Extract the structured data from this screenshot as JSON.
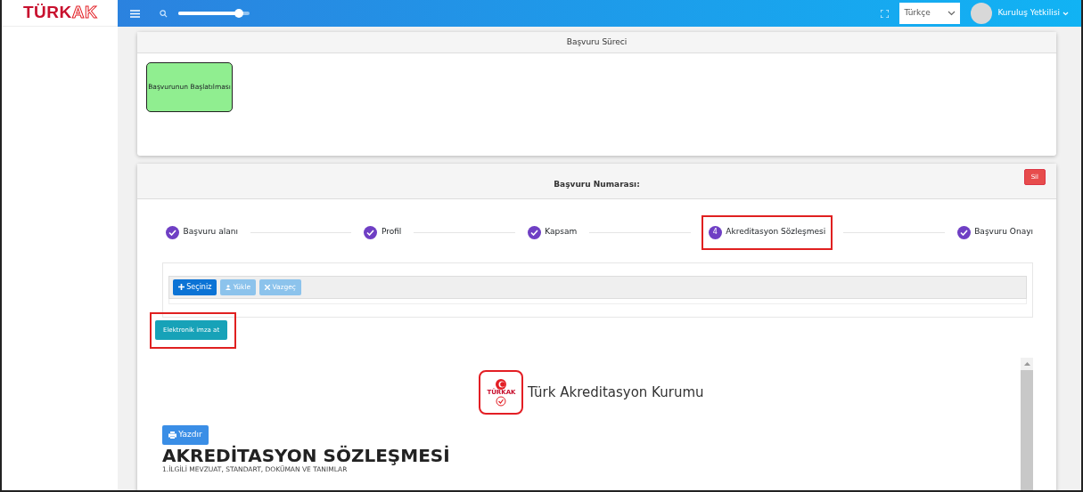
{
  "brand": {
    "main": "TÜRK",
    "accent": "AK"
  },
  "topbar": {
    "search_slider": {
      "level": 0.85
    },
    "language": "Türkçe",
    "user": "Kuruluş Yetkilisi"
  },
  "process_card": {
    "title": "Başvuru Süreci",
    "stages": [
      {
        "label": "Başvurunun Başlatılması",
        "color": "#90ee90"
      }
    ]
  },
  "application_card": {
    "title": "Başvuru Numarası:",
    "delete_button": "Sil",
    "steps": [
      {
        "label": "Başvuru alanı",
        "completed": true,
        "highlighted": false
      },
      {
        "label": "Profil",
        "completed": true,
        "highlighted": false
      },
      {
        "label": "Kapsam",
        "completed": true,
        "highlighted": false
      },
      {
        "number": "4",
        "label": "Akreditasyon Sözleşmesi",
        "completed": false,
        "highlighted": true
      },
      {
        "label": "Başvuru Onayı",
        "completed": true,
        "highlighted": false
      }
    ],
    "upload": {
      "buttons": [
        {
          "kind": "choose",
          "label": "Seçiniz",
          "disabled": false
        },
        {
          "kind": "upload",
          "label": "Yükle",
          "disabled": true
        },
        {
          "kind": "cancel",
          "label": "Vazgeç",
          "disabled": true
        }
      ]
    },
    "sign_button": {
      "label": "Elektronik imza at",
      "highlighted": true
    },
    "document": {
      "emblem_text": "TÜRKAK",
      "org_name": "Türk Akreditasyon Kurumu",
      "print_button": "Yazdır",
      "title": "AKREDİTASYON SÖZLEŞMESİ",
      "section": "1.İLGİLİ MEVZUAT, STANDART, DOKÜMAN VE TANIMLAR"
    }
  }
}
